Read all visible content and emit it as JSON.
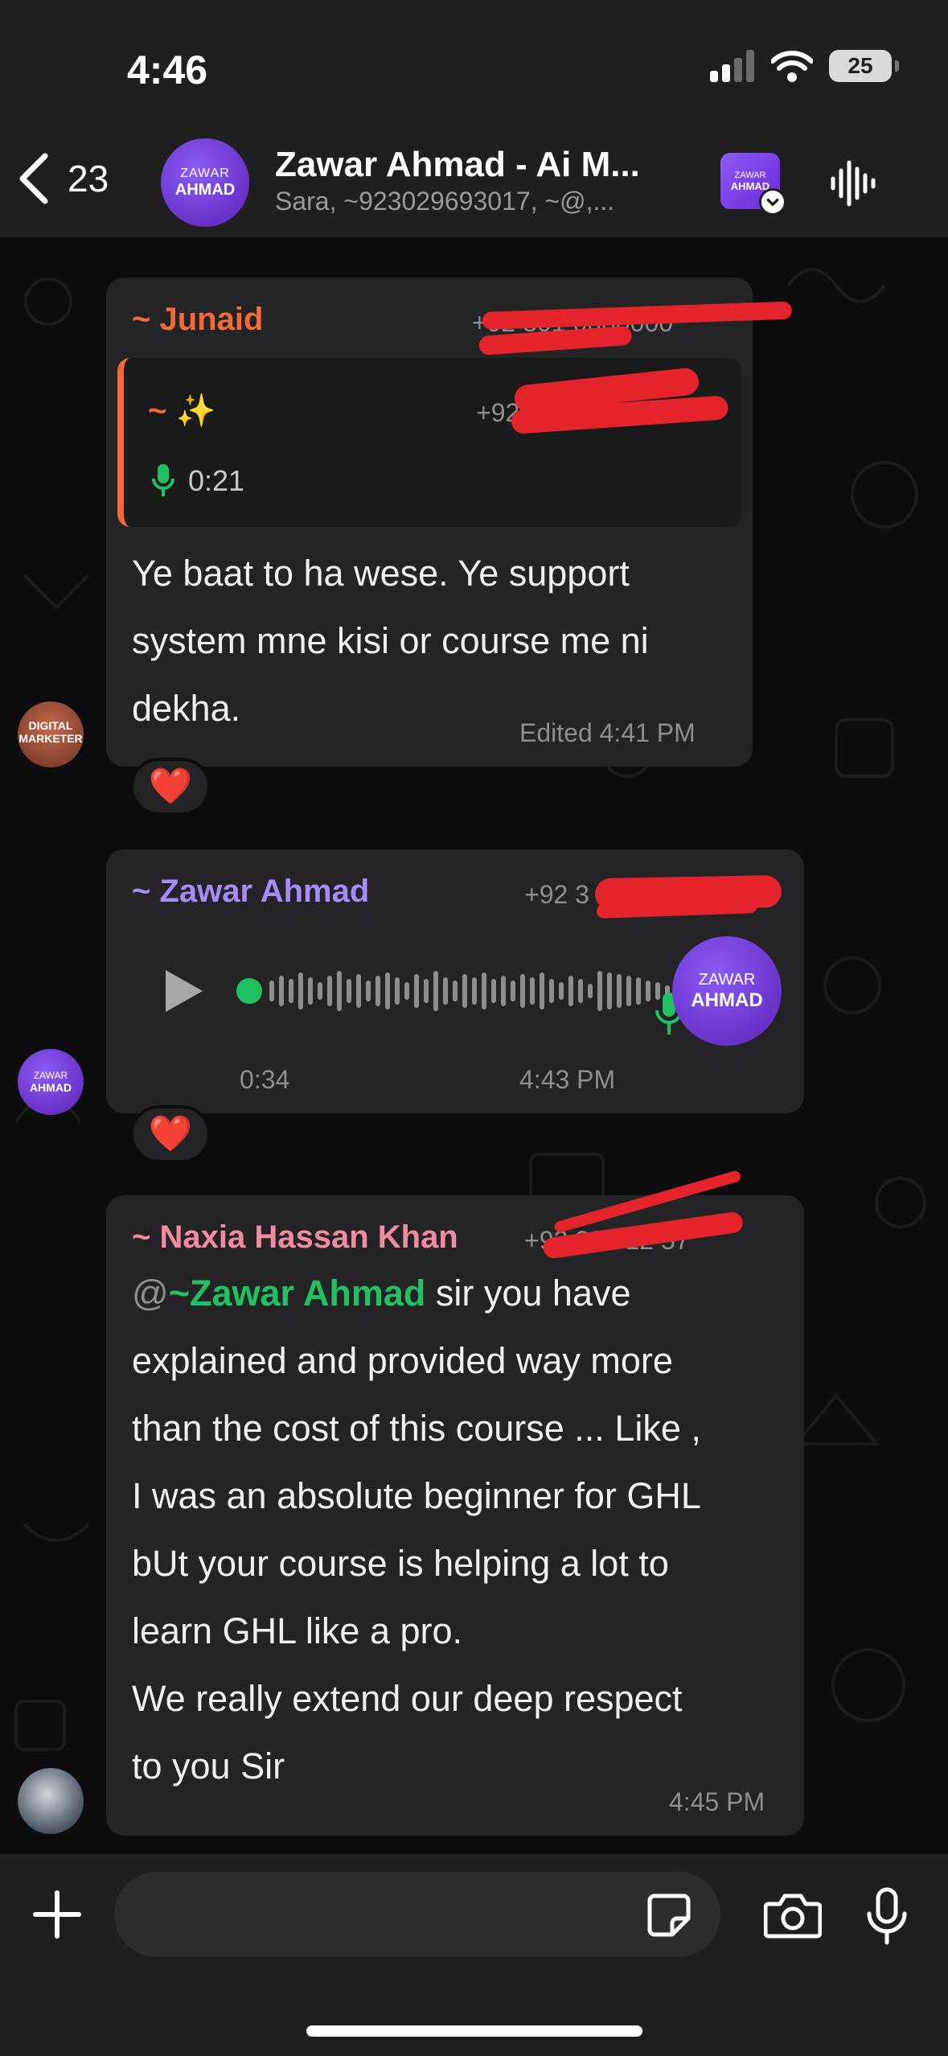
{
  "status_bar": {
    "time": "4:46",
    "battery": "25",
    "icons": [
      "cellular-signal-icon",
      "wifi-icon",
      "battery-icon"
    ]
  },
  "header": {
    "back_count": "23",
    "group_avatar_line1": "ZAWAR",
    "group_avatar_line2": "AHMAD",
    "title": "Zawar Ahmad - Ai M...",
    "subtitle": "Sara, ~923029693017, ~@,...",
    "tag_line1": "ZAWAR",
    "tag_line2": "AHMAD"
  },
  "messages": [
    {
      "sender": "~ Junaid",
      "sender_color": "#f26a3a",
      "phone": "+92 301 0000000",
      "quoted": {
        "sender": "~ ✨",
        "phone": "+92 3",
        "voice_duration": "0:21"
      },
      "lines": [
        "Ye baat to ha wese. Ye support",
        "system mne kisi or course me ni",
        "dekha."
      ],
      "edited": "Edited",
      "time": "4:41 PM",
      "reaction": "❤️",
      "avatar_text": "DIGITAL MARKETER"
    },
    {
      "sender": "~ Zawar Ahmad",
      "sender_color": "#a78bfa",
      "phone": "+92 3",
      "voice_duration": "0:34",
      "time": "4:43 PM",
      "voice_avatar_line1": "ZAWAR",
      "voice_avatar_line2": "AHMAD",
      "reaction": "❤️"
    },
    {
      "sender": "~ Naxia Hassan Khan",
      "sender_color": "#f28ba0",
      "phone": "+92 306 12   57",
      "mention_at": "@",
      "mention": "~Zawar Ahmad",
      "first_line_rest": " sir you have",
      "lines": [
        "explained and provided way more",
        "than the cost of this course ... Like ,",
        "I was an absolute beginner for GHL",
        "bUt your course is helping a lot to",
        "learn GHL like a pro.",
        "We really extend our deep respect",
        "to you Sir"
      ],
      "time": "4:45 PM"
    }
  ],
  "colors": {
    "accent_green": "#21c063",
    "bubble": "#242426",
    "background": "#0d0d0e"
  }
}
